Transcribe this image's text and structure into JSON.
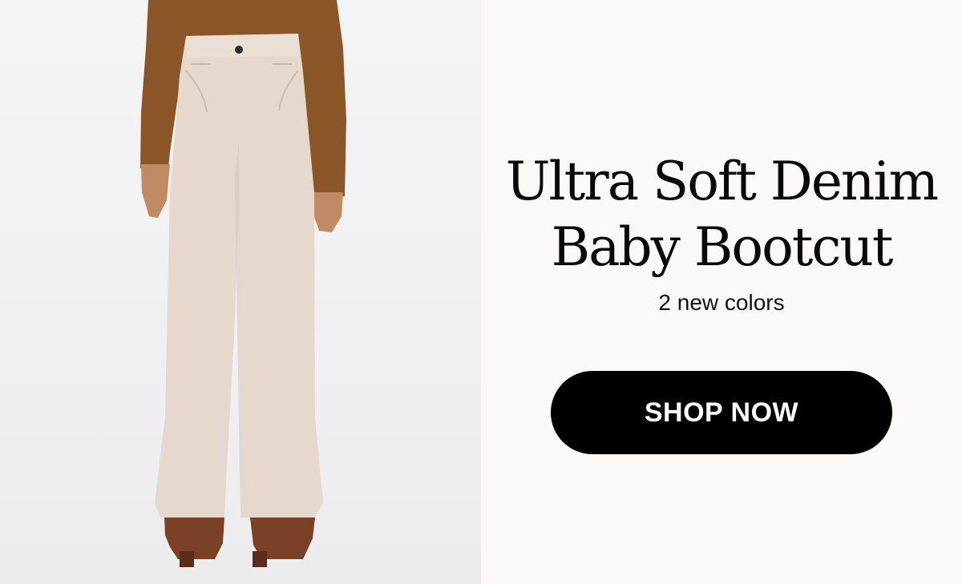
{
  "hero": {
    "headline_line1": "Ultra Soft Denim",
    "headline_line2": "Baby Bootcut",
    "subheadline": "2 new colors",
    "cta_label": "SHOP NOW"
  },
  "colors": {
    "page_background": "#fbf9f8",
    "photo_background": "#f2f2f3",
    "cta_background": "#000000",
    "cta_text": "#ffffff",
    "pants": "#e6d8cc",
    "top": "#8a5628",
    "boots": "#7a4126",
    "skin": "#c08a64"
  },
  "image": {
    "subject": "model wearing light beige bootcut pants, brown long-sleeve top and brown ankle boots"
  }
}
